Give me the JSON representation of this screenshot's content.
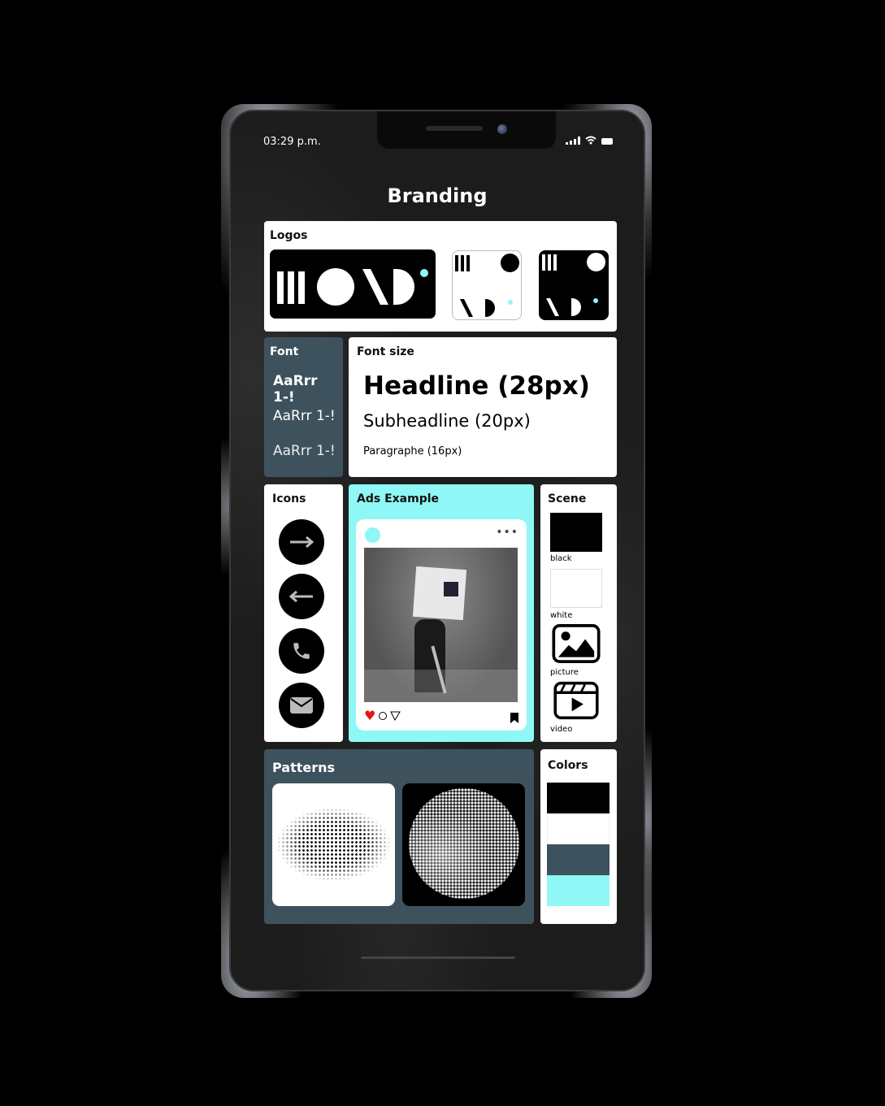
{
  "status_bar": {
    "time": "03:29 p.m.",
    "icons": [
      "signal-icon",
      "wifi-icon",
      "battery-icon"
    ]
  },
  "header": {
    "title": "Branding"
  },
  "logos": {
    "label": "Logos",
    "accent": "#8ff7f5",
    "items": [
      "wordmark-black",
      "monogram-white",
      "monogram-black"
    ]
  },
  "font": {
    "label": "Font",
    "samples": [
      "AaRrr 1-!",
      "AaRrr 1-!",
      "AaRrr 1-!"
    ],
    "weights": [
      "bold",
      "regular",
      "light"
    ]
  },
  "font_size": {
    "label": "Font size",
    "headline": "Headline (28px)",
    "subheadline": "Subheadline (20px)",
    "paragraph": "Paragraphe (16px)"
  },
  "icons": {
    "label": "Icons",
    "items": [
      "arrow-right-icon",
      "arrow-left-icon",
      "phone-icon",
      "mail-icon"
    ]
  },
  "ads": {
    "label": "Ads Example",
    "more": "•••",
    "liked": true
  },
  "scene": {
    "label": "Scene",
    "items": [
      {
        "label": "black",
        "kind": "swatch",
        "color": "#000000"
      },
      {
        "label": "white",
        "kind": "swatch",
        "color": "#ffffff"
      },
      {
        "label": "picture",
        "kind": "icon"
      },
      {
        "label": "video",
        "kind": "icon"
      }
    ]
  },
  "patterns": {
    "label": "Patterns",
    "items": [
      "halftone-light",
      "halftone-dark"
    ]
  },
  "colors": {
    "label": "Colors",
    "swatches": [
      "#000000",
      "#ffffff",
      "#3e525d",
      "#8ff7f5"
    ]
  }
}
